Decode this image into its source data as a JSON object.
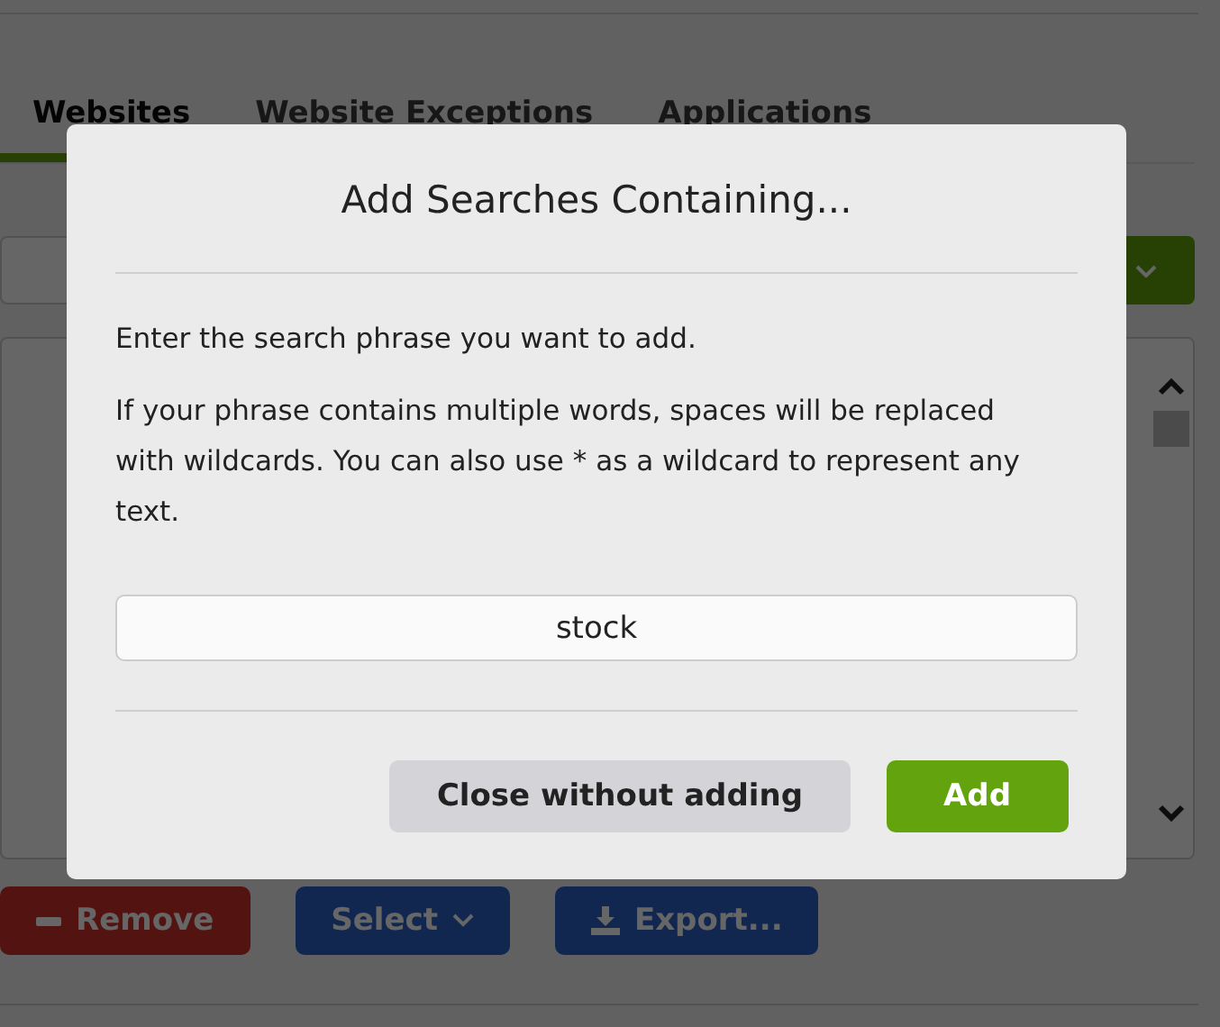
{
  "background": {
    "tabs": [
      {
        "label": "Websites",
        "selected": true
      },
      {
        "label": "Website Exceptions",
        "selected": false
      },
      {
        "label": "Applications",
        "selected": false
      }
    ],
    "buttons": [
      {
        "label": "Remove",
        "kind": "danger"
      },
      {
        "label": "Select",
        "kind": "menu"
      },
      {
        "label": "Export...",
        "kind": "export"
      }
    ]
  },
  "dialog": {
    "title": "Add Searches Containing...",
    "paragraphs": [
      "Enter the search phrase you want to add.",
      "If your phrase contains multiple words, spaces will be replaced with wildcards. You can also use * as a wildcard to represent any text."
    ],
    "input": {
      "value": "stock"
    },
    "buttons": [
      {
        "label": "Close without adding",
        "kind": "secondary"
      },
      {
        "label": "Add",
        "kind": "primary"
      }
    ]
  }
}
